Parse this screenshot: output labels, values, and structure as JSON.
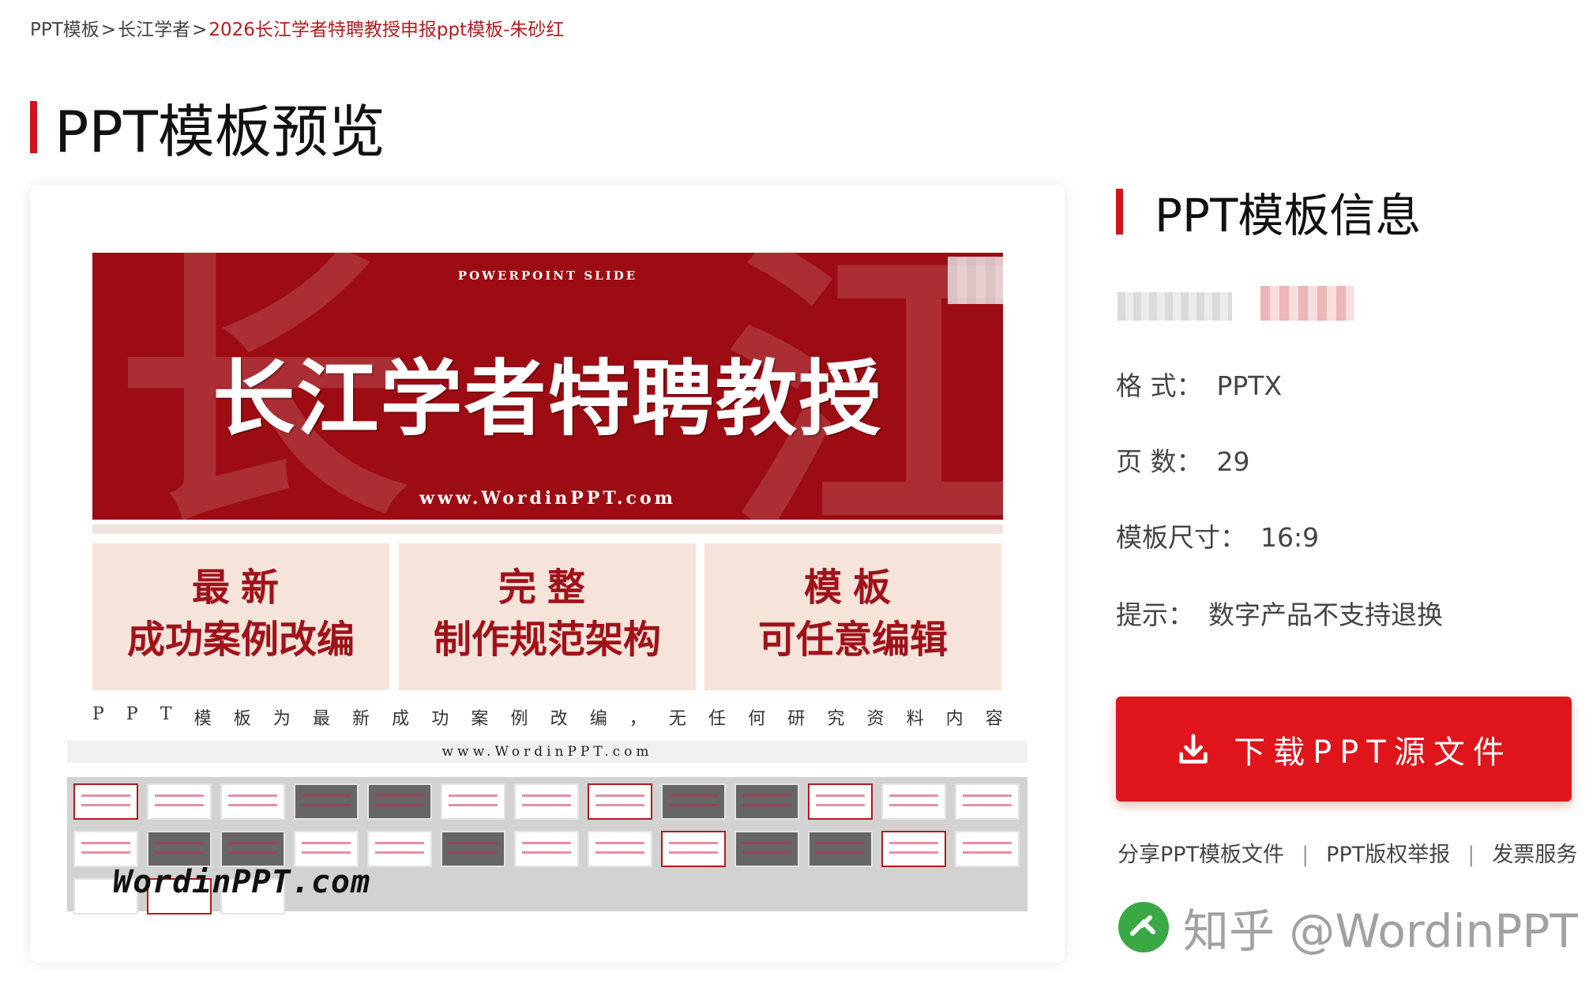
{
  "breadcrumb": {
    "items": [
      "PPT模板",
      "长江学者"
    ],
    "current": "2026长江学者特聘教授申报ppt模板-朱砂红",
    "separator": ">"
  },
  "preview": {
    "title": "PPT模板预览",
    "slide": {
      "watermark_left": "长",
      "watermark_right": "江",
      "subtitle": "POWERPOINT SLIDE",
      "main_title": "长江学者特聘教授",
      "url": "www.WordinPPT.com"
    },
    "features": [
      {
        "line1": "最新",
        "line2": "成功案例改编"
      },
      {
        "line1": "完整",
        "line2": "制作规范架构"
      },
      {
        "line1": "模板",
        "line2": "可任意编辑"
      }
    ],
    "description_chars": [
      "P",
      "P",
      "T",
      "模",
      "板",
      "为",
      "最",
      "新",
      "成",
      "功",
      "案",
      "例",
      "改",
      "编",
      "，",
      "无",
      "任",
      "何",
      "研",
      "究",
      "资",
      "料",
      "内",
      "容"
    ],
    "url_bar": "www.WordinPPT.com",
    "thumbnail_watermark": "WordinPPT.com"
  },
  "info": {
    "title": "PPT模板信息",
    "rows": [
      {
        "label": "格 式：",
        "value": "PPTX"
      },
      {
        "label": "页 数：",
        "value": "29"
      },
      {
        "label": "模板尺寸：",
        "value": "16:9"
      },
      {
        "label": "提示：",
        "value": "数字产品不支持退换"
      }
    ],
    "download_label": "下载PPT源文件",
    "links": [
      "分享PPT模板文件",
      "PPT版权举报",
      "发票服务"
    ],
    "link_separator": "|"
  },
  "watermark": {
    "text": "知乎 @WordinPPT"
  },
  "colors": {
    "accent": "#d0151b",
    "slide_red": "#9c0c12",
    "download": "#e0141b",
    "feature_bg": "#f6e4db",
    "zhihu_green": "#3aa845"
  }
}
